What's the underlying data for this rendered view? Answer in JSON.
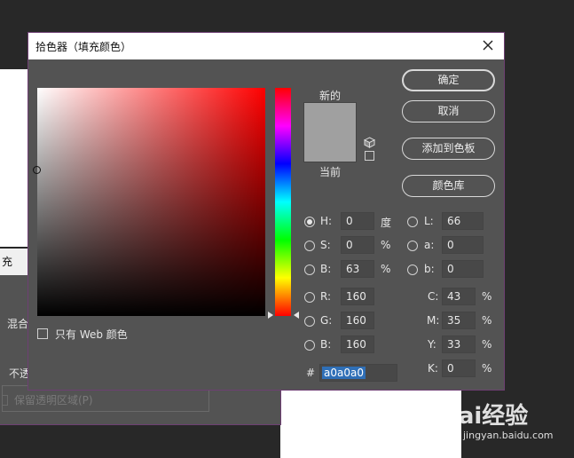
{
  "picker": {
    "title": "拾色器（填充颜色）",
    "new_label": "新的",
    "current_label": "当前",
    "buttons": {
      "ok": "确定",
      "cancel": "取消",
      "add_swatch": "添加到色板",
      "library": "颜色库"
    },
    "web_only_label": "只有 Web 颜色",
    "hsb": {
      "h": {
        "label": "H:",
        "value": "0",
        "unit": "度"
      },
      "s": {
        "label": "S:",
        "value": "0",
        "unit": "%"
      },
      "b": {
        "label": "B:",
        "value": "63",
        "unit": "%"
      }
    },
    "rgb": {
      "r": {
        "label": "R:",
        "value": "160"
      },
      "g": {
        "label": "G:",
        "value": "160"
      },
      "b": {
        "label": "B:",
        "value": "160"
      }
    },
    "lab": {
      "l": {
        "label": "L:",
        "value": "66"
      },
      "a": {
        "label": "a:",
        "value": "0"
      },
      "b": {
        "label": "b:",
        "value": "0"
      }
    },
    "cmyk": {
      "c": {
        "label": "C:",
        "value": "43",
        "unit": "%"
      },
      "m": {
        "label": "M:",
        "value": "35",
        "unit": "%"
      },
      "y": {
        "label": "Y:",
        "value": "33",
        "unit": "%"
      },
      "k": {
        "label": "K:",
        "value": "0",
        "unit": "%"
      }
    },
    "hex_prefix": "#",
    "hex_value": "a0a0a0",
    "colors": {
      "new": "#a0a0a0",
      "current": "#a0a0a0",
      "dialog_bg": "#535353",
      "accent_border": "#6e3f73"
    }
  },
  "background_dialog": {
    "title_fragment": "充",
    "blend_label_fragment": "混合",
    "opacity_label_fragment": "不透",
    "preserve_transparency": "保留透明区域(P)"
  },
  "watermark": {
    "brand": "Bai经验",
    "url": "jingyan.baidu.com"
  }
}
